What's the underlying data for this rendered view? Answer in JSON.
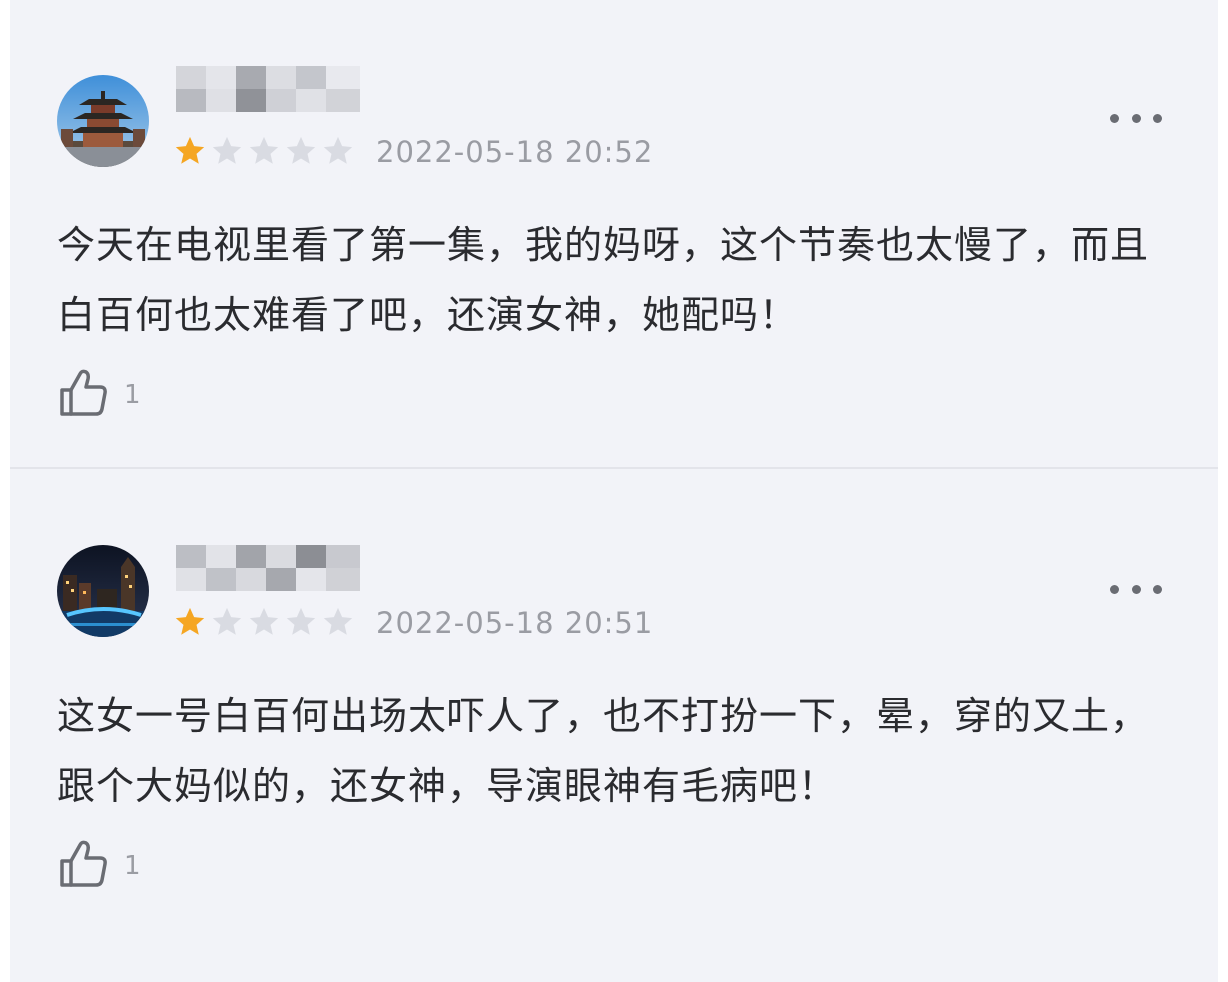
{
  "reviews": [
    {
      "avatar": "pagoda-photo",
      "username_obscured": true,
      "rating": 1,
      "rating_max": 5,
      "timestamp": "2022-05-18 20:52",
      "content": "今天在电视里看了第一集，我的妈呀，这个节奏也太慢了，而且白百何也太难看了吧，还演女神，她配吗！",
      "likes": "1",
      "more_icon": "more-dots-icon",
      "like_icon": "thumbs-up-icon"
    },
    {
      "avatar": "night-city-photo",
      "username_obscured": true,
      "rating": 1,
      "rating_max": 5,
      "timestamp": "2022-05-18 20:51",
      "content": "这女一号白百何出场太吓人了，也不打扮一下，晕，穿的又土，跟个大妈似的，还女神，导演眼神有毛病吧！",
      "likes": "1",
      "more_icon": "more-dots-icon",
      "like_icon": "thumbs-up-icon"
    }
  ],
  "colors": {
    "background": "#f2f3f8",
    "star_filled": "#f5a623",
    "star_empty": "#d9dbe2",
    "meta_text": "#9a9ca3",
    "body_text": "#2a2b2f"
  }
}
